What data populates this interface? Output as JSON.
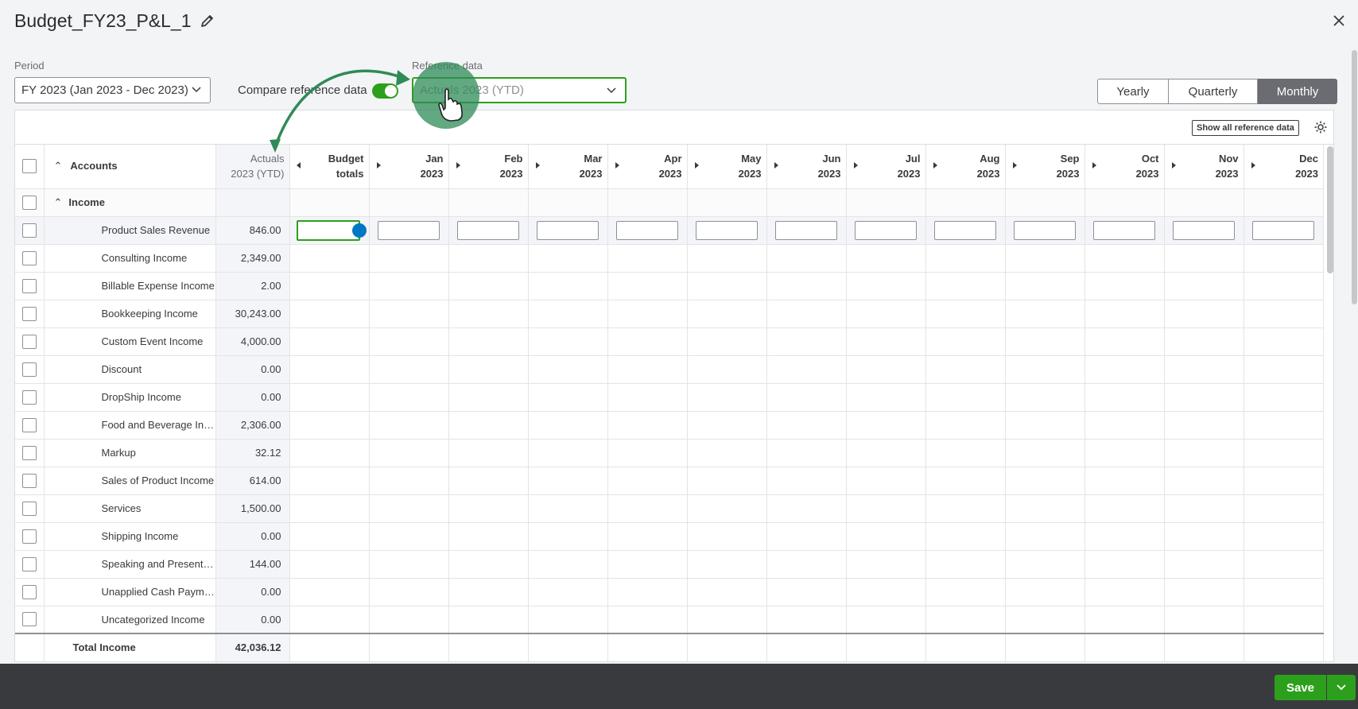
{
  "header": {
    "title": "Budget_FY23_P&L_1",
    "edit_icon": "pencil-icon",
    "close_icon": "close-icon"
  },
  "period": {
    "label": "Period",
    "value": "FY 2023 (Jan 2023 - Dec 2023)"
  },
  "compare": {
    "label": "Compare reference data",
    "enabled": true
  },
  "reference": {
    "label": "Reference data",
    "value": "Actuals 2023 (YTD)"
  },
  "view_toggle": {
    "options": [
      "Yearly",
      "Quarterly",
      "Monthly"
    ],
    "selected": "Monthly"
  },
  "grid": {
    "show_ref_label": "Show all reference data",
    "headers": {
      "accounts": "Accounts",
      "actuals_1": "Actuals",
      "actuals_2": "2023 (YTD)",
      "budget_1": "Budget",
      "budget_2": "totals",
      "months": [
        {
          "m": "Jan",
          "y": "2023"
        },
        {
          "m": "Feb",
          "y": "2023"
        },
        {
          "m": "Mar",
          "y": "2023"
        },
        {
          "m": "Apr",
          "y": "2023"
        },
        {
          "m": "May",
          "y": "2023"
        },
        {
          "m": "Jun",
          "y": "2023"
        },
        {
          "m": "Jul",
          "y": "2023"
        },
        {
          "m": "Aug",
          "y": "2023"
        },
        {
          "m": "Sep",
          "y": "2023"
        },
        {
          "m": "Oct",
          "y": "2023"
        },
        {
          "m": "Nov",
          "y": "2023"
        },
        {
          "m": "Dec",
          "y": "2023"
        }
      ]
    },
    "group": "Income",
    "rows": [
      {
        "account": "Product Sales Revenue",
        "actual": "846.00"
      },
      {
        "account": "Consulting Income",
        "actual": "2,349.00"
      },
      {
        "account": "Billable Expense Income",
        "actual": "2.00"
      },
      {
        "account": "Bookkeeping Income",
        "actual": "30,243.00"
      },
      {
        "account": "Custom Event Income",
        "actual": "4,000.00"
      },
      {
        "account": "Discount",
        "actual": "0.00"
      },
      {
        "account": "DropShip Income",
        "actual": "0.00"
      },
      {
        "account": "Food and Beverage Income",
        "actual": "2,306.00"
      },
      {
        "account": "Markup",
        "actual": "32.12"
      },
      {
        "account": "Sales of Product Income",
        "actual": "614.00"
      },
      {
        "account": "Services",
        "actual": "1,500.00"
      },
      {
        "account": "Shipping Income",
        "actual": "0.00"
      },
      {
        "account": "Speaking and Presentation I...",
        "actual": "144.00"
      },
      {
        "account": "Unapplied Cash Payment In...",
        "actual": "0.00"
      },
      {
        "account": "Uncategorized Income",
        "actual": "0.00"
      }
    ],
    "total": {
      "label": "Total Income",
      "actual": "42,036.12"
    }
  },
  "footer": {
    "save_label": "Save"
  },
  "colors": {
    "accent": "#2ca01c",
    "footer": "#393a3d",
    "info": "#0077c5"
  }
}
